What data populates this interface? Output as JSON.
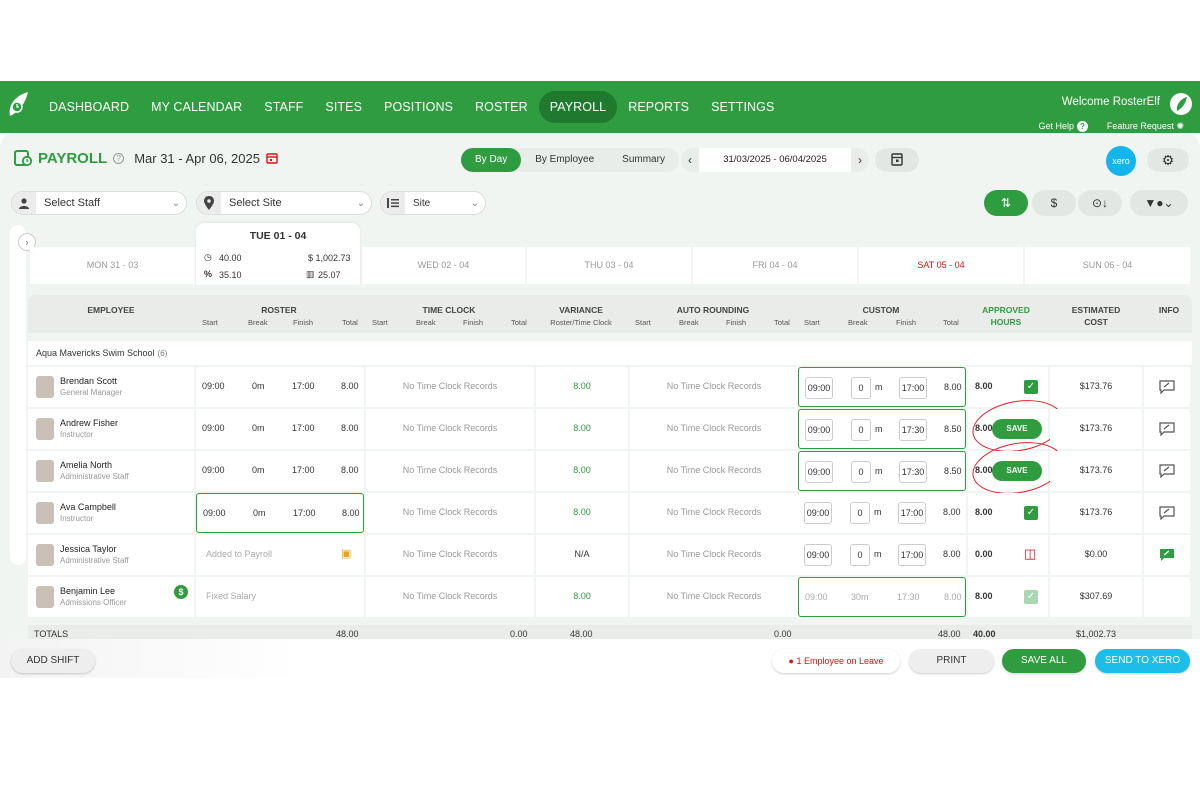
{
  "nav": {
    "items": [
      "DASHBOARD",
      "MY CALENDAR",
      "STAFF",
      "SITES",
      "POSITIONS",
      "ROSTER",
      "PAYROLL",
      "REPORTS",
      "SETTINGS"
    ],
    "active": "PAYROLL",
    "welcome": "Welcome RosterElf",
    "get_help": "Get Help",
    "feature_request": "Feature Request"
  },
  "header": {
    "title": "PAYROLL",
    "date_range": "Mar 31 - Apr 06, 2025",
    "view_tabs": [
      "By Day",
      "By Employee",
      "Summary"
    ],
    "active_tab": "By Day",
    "period": "31/03/2025 - 06/04/2025",
    "xero_label": "xero"
  },
  "filters": {
    "staff_placeholder": "Select Staff",
    "site_placeholder": "Select Site",
    "group_by": "Site"
  },
  "days": {
    "mon": "MON 31 - 03",
    "tue": "TUE 01 - 04",
    "wed": "WED 02 - 04",
    "thu": "THU 03 - 04",
    "fri": "FRI 04 - 04",
    "sat": "SAT 05 - 04",
    "sun": "SUN 06 - 04",
    "tue_hours": "40.00",
    "tue_cost": "$ 1,002.73",
    "tue_percent": "35.10",
    "tue_stat": "25.07"
  },
  "columns": {
    "employee": "EMPLOYEE",
    "roster": "ROSTER",
    "time_clock": "TIME CLOCK",
    "variance": "VARIANCE",
    "variance_sub": "Roster/Time Clock",
    "auto_rounding": "AUTO ROUNDING",
    "custom": "CUSTOM",
    "approved_1": "APPROVED",
    "approved_2": "HOURS",
    "estimated_1": "ESTIMATED",
    "estimated_2": "COST",
    "info": "INFO",
    "start": "Start",
    "break": "Break",
    "finish": "Finish",
    "total": "Total"
  },
  "group": {
    "name": "Aqua Mavericks Swim School",
    "count": "(6)"
  },
  "rows": [
    {
      "name": "Brendan Scott",
      "role": "General Manager",
      "r_start": "09:00",
      "r_break": "0m",
      "r_finish": "17:00",
      "r_total": "8.00",
      "tc": "No Time Clock Records",
      "variance": "8.00",
      "ar": "No Time Clock Records",
      "c_start": "09:00",
      "c_break": "0",
      "c_unit": "m",
      "c_finish": "17:00",
      "c_total": "8.00",
      "approved": "8.00",
      "cost": "$173.76"
    },
    {
      "name": "Andrew Fisher",
      "role": "Instructor",
      "r_start": "09:00",
      "r_break": "0m",
      "r_finish": "17:00",
      "r_total": "8.00",
      "tc": "No Time Clock Records",
      "variance": "8.00",
      "ar": "No Time Clock Records",
      "c_start": "09:00",
      "c_break": "0",
      "c_unit": "m",
      "c_finish": "17:30",
      "c_total": "8.50",
      "approved": "8.00",
      "save": "SAVE",
      "cost": "$173.76"
    },
    {
      "name": "Amelia North",
      "role": "Administrative Staff",
      "r_start": "09:00",
      "r_break": "0m",
      "r_finish": "17:00",
      "r_total": "8.00",
      "tc": "No Time Clock Records",
      "variance": "8.00",
      "ar": "No Time Clock Records",
      "c_start": "09:00",
      "c_break": "0",
      "c_unit": "m",
      "c_finish": "17:30",
      "c_total": "8.50",
      "approved": "8.00",
      "save": "SAVE",
      "cost": "$173.76"
    },
    {
      "name": "Ava Campbell",
      "role": "Instructor",
      "r_start": "09:00",
      "r_break": "0m",
      "r_finish": "17:00",
      "r_total": "8.00",
      "tc": "No Time Clock Records",
      "variance": "8.00",
      "ar": "No Time Clock Records",
      "c_start": "09:00",
      "c_break": "0",
      "c_unit": "m",
      "c_finish": "17:00",
      "c_total": "8.00",
      "approved": "8.00",
      "cost": "$173.76"
    },
    {
      "name": "Jessica Taylor",
      "role": "Administrative Staff",
      "r_text": "Added to Payroll",
      "tc": "No Time Clock Records",
      "variance": "N/A",
      "ar": "No Time Clock Records",
      "c_start": "09:00",
      "c_break": "0",
      "c_unit": "m",
      "c_finish": "17:00",
      "c_total": "8.00",
      "approved": "0.00",
      "cost": "$0.00"
    },
    {
      "name": "Benjamin Lee",
      "role": "Admissions Officer",
      "badge": "$",
      "r_text": "Fixed Salary",
      "tc": "No Time Clock Records",
      "variance": "8.00",
      "ar": "No Time Clock Records",
      "c_start": "09:00",
      "c_break": "30m",
      "c_finish": "17:30",
      "c_total": "8.00",
      "approved": "8.00",
      "cost": "$307.69"
    }
  ],
  "totals": {
    "label": "TOTALS",
    "roster": "48.00",
    "time_clock": "0.00",
    "variance": "48.00",
    "auto_rounding": "0.00",
    "custom": "48.00",
    "approved": "40.00",
    "cost": "$1,002.73"
  },
  "footer": {
    "add_shift": "ADD SHIFT",
    "leave": "1 Employee on Leave",
    "print": "PRINT",
    "save_all": "SAVE ALL",
    "send_xero": "SEND TO XERO"
  },
  "colors": {
    "brand": "#2e9c3f",
    "xero": "#13b5ea",
    "alert": "#e0202a"
  }
}
